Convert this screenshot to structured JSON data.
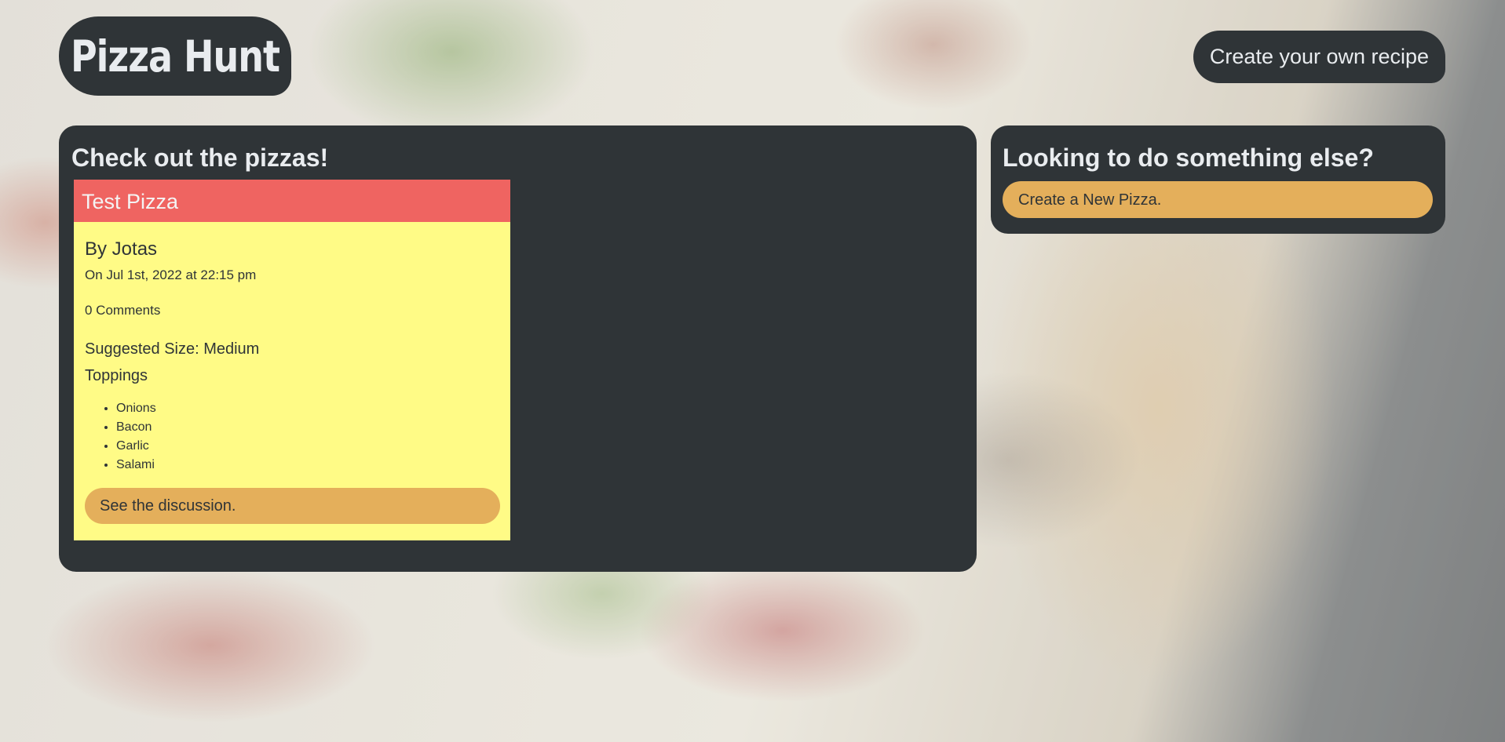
{
  "header": {
    "logo_text": "Pizza Hunt",
    "create_recipe_label": "Create your own recipe"
  },
  "main": {
    "title": "Check out the pizzas!",
    "pizzas": [
      {
        "name": "Test Pizza",
        "author": "By Jotas",
        "date": "On Jul 1st, 2022 at 22:15 pm",
        "comments": "0 Comments",
        "size": "Suggested Size: Medium",
        "toppings_title": "Toppings",
        "toppings": [
          "Onions",
          "Bacon",
          "Garlic",
          "Salami"
        ],
        "discussion_label": "See the discussion."
      }
    ]
  },
  "sidebar": {
    "title": "Looking to do something else?",
    "new_pizza_label": "Create a New Pizza."
  },
  "colors": {
    "panel": "#2f3437",
    "card_body": "#fffb86",
    "card_header": "#ef6461",
    "button": "#e4af5b",
    "text_light": "#e9ecef"
  }
}
